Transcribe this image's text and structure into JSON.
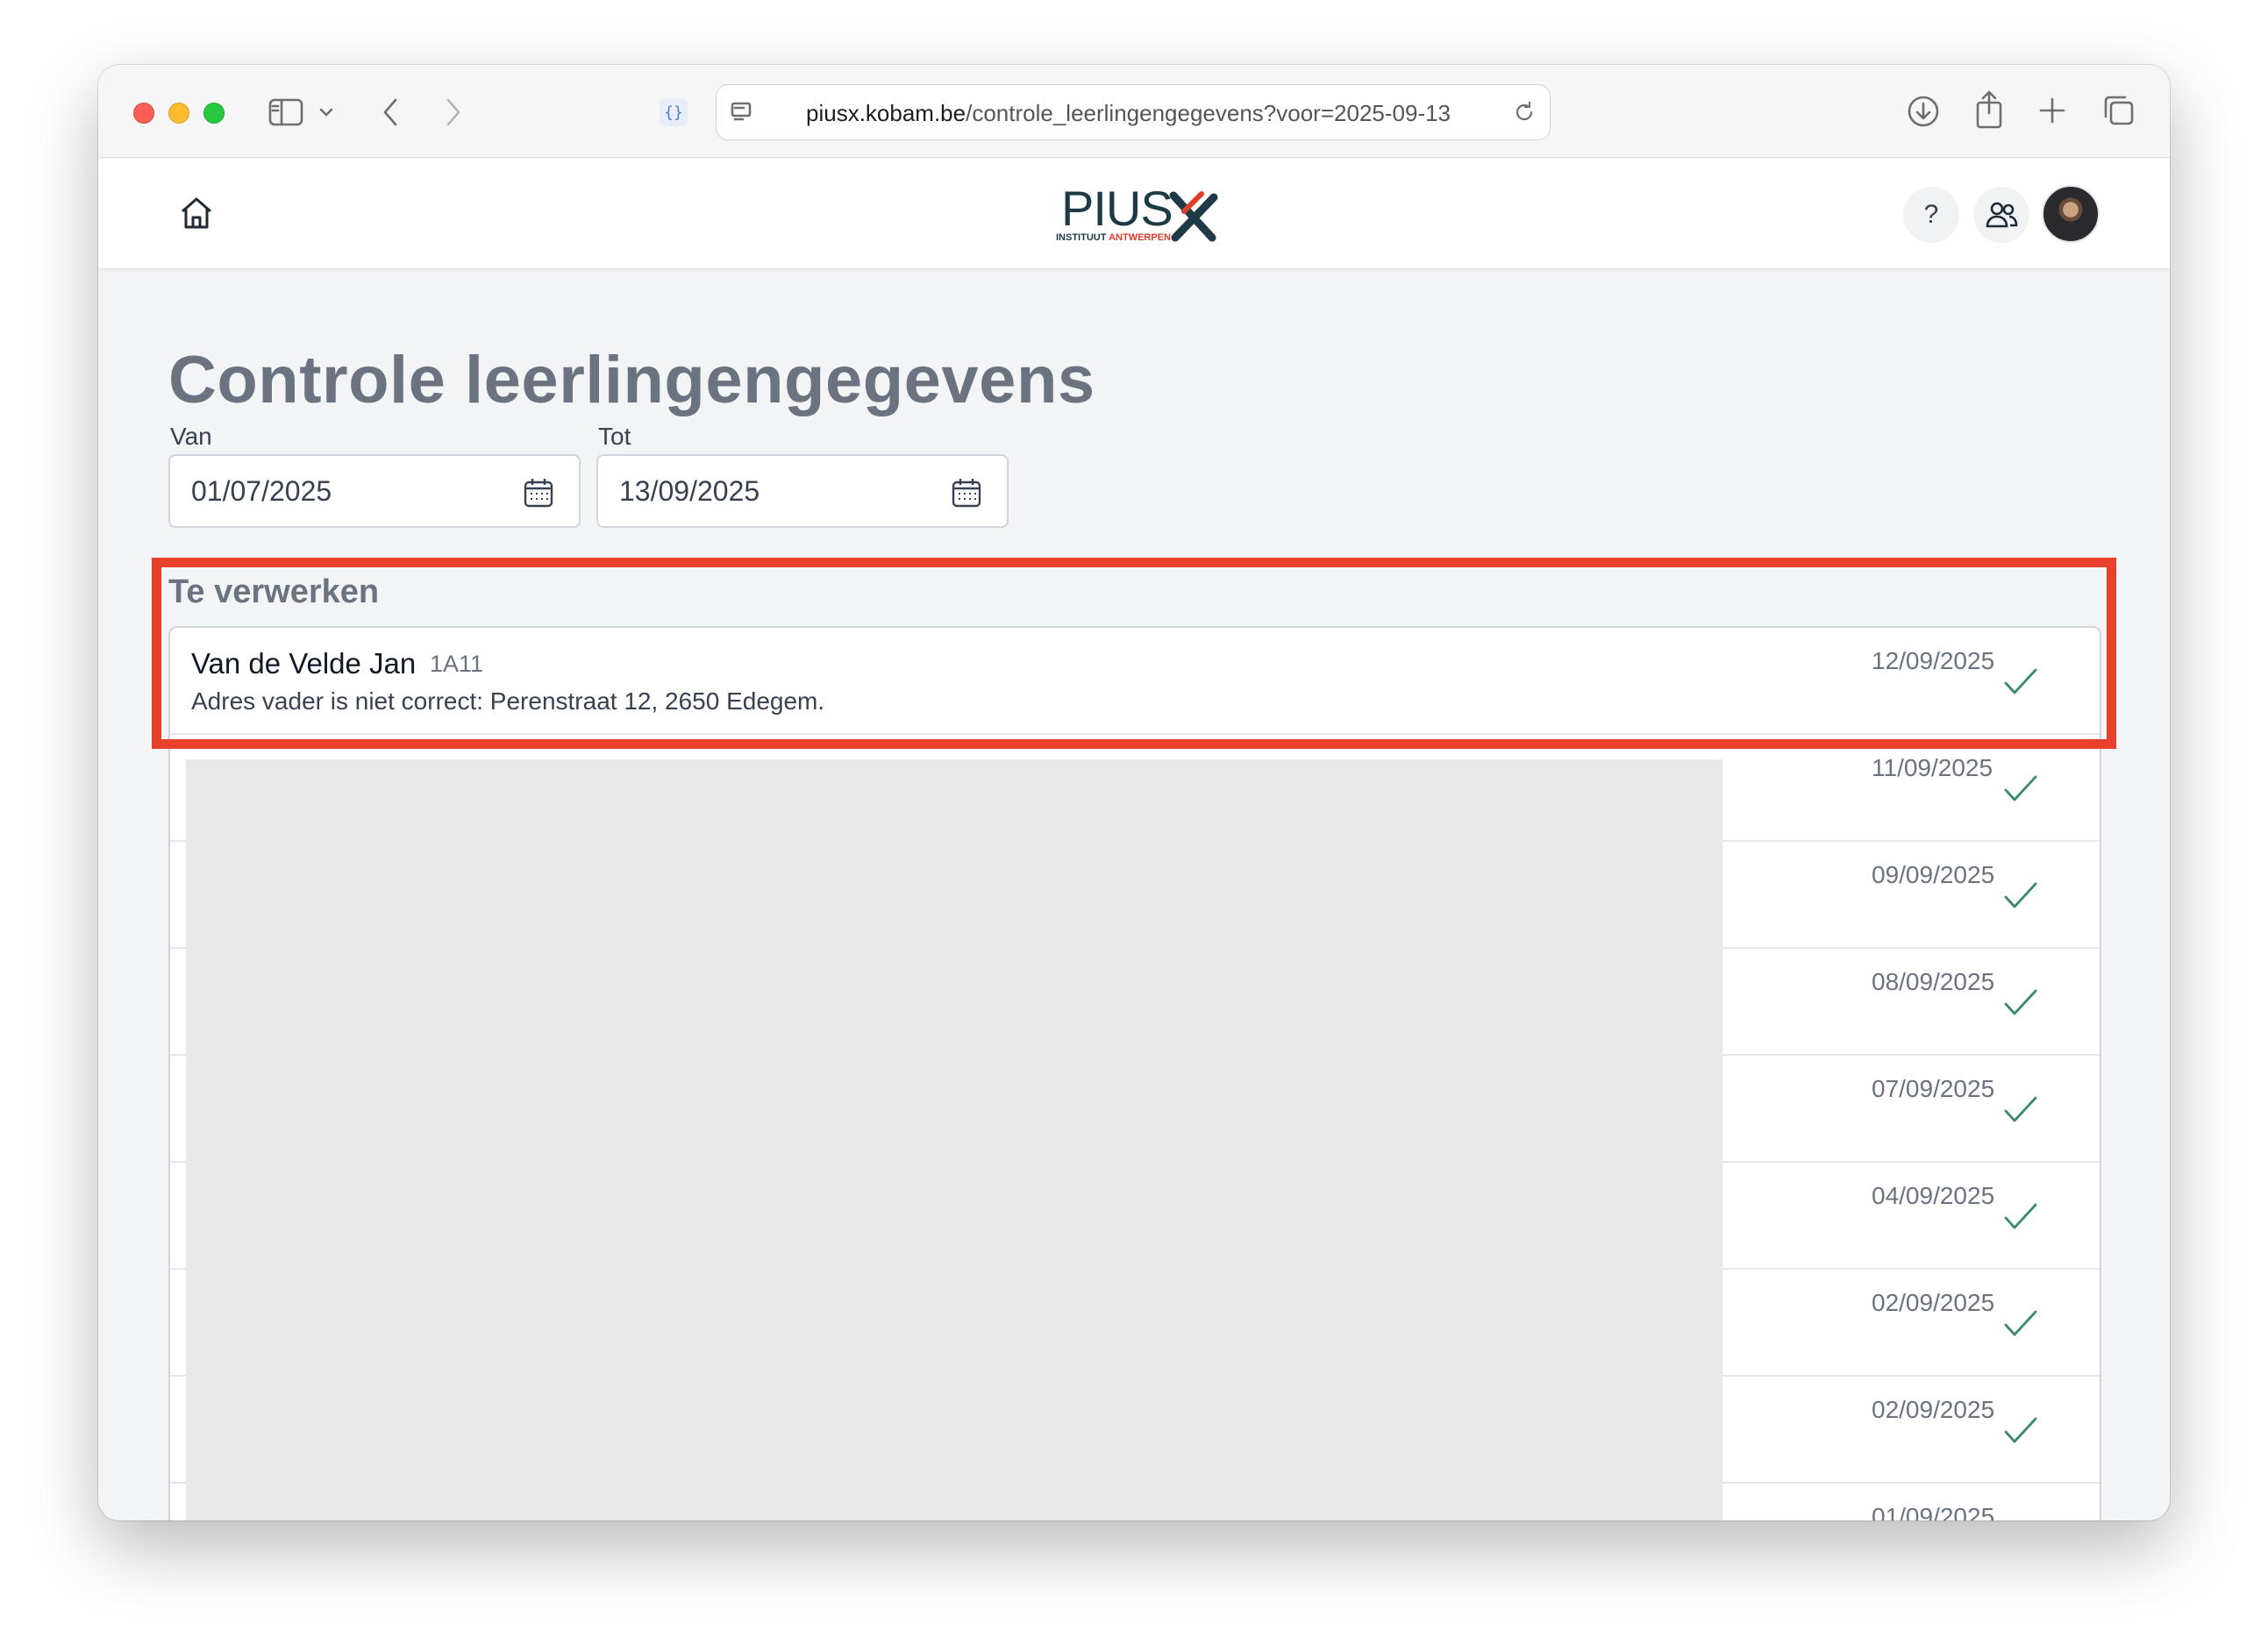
{
  "browser": {
    "url_domain": "piusx.kobam.be",
    "url_path": "/controle_leerlingengegevens?voor=2025-09-13"
  },
  "app": {
    "logo_word": "PIUS",
    "logo_sub_left": "INSTITUUT",
    "logo_sub_right": "ANTWERPEN",
    "help_label": "?"
  },
  "page": {
    "title": "Controle leerlingengegevens",
    "filters": {
      "van_label": "Van",
      "van_value": "01/07/2025",
      "tot_label": "Tot",
      "tot_value": "13/09/2025"
    },
    "section_title": "Te verwerken",
    "rows": [
      {
        "name": "Van de Velde Jan",
        "class": "1A11",
        "message": "Adres vader is niet correct: Perenstraat 12, 2650 Edegem.",
        "date": "12/09/2025"
      },
      {
        "date": "11/09/2025"
      },
      {
        "date": "09/09/2025"
      },
      {
        "date": "08/09/2025"
      },
      {
        "date": "07/09/2025"
      },
      {
        "date": "04/09/2025"
      },
      {
        "date": "02/09/2025"
      },
      {
        "date": "02/09/2025"
      },
      {
        "date": "01/09/2025"
      }
    ]
  },
  "colors": {
    "highlight": "#e8402a",
    "check": "#3a8a6a",
    "title": "#6b7280"
  }
}
